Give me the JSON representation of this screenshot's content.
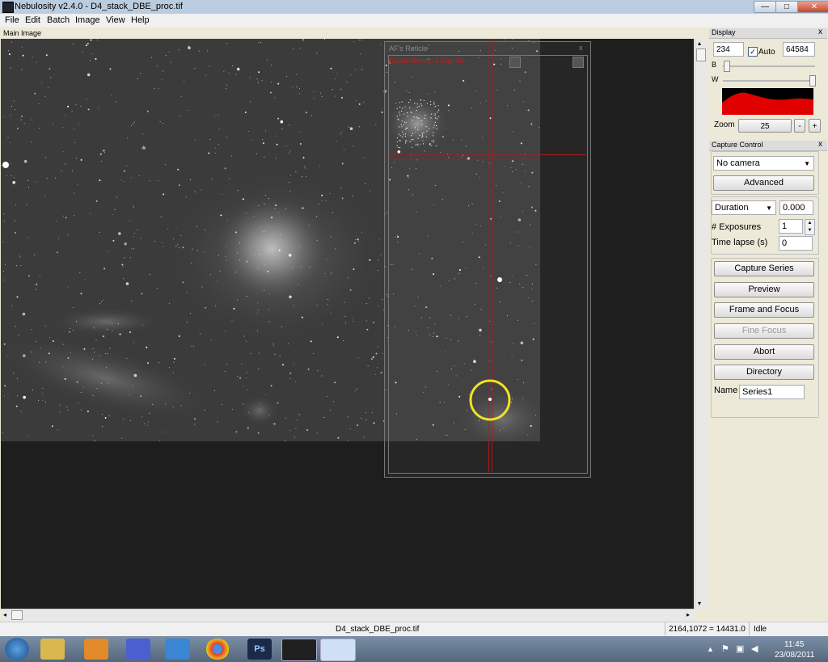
{
  "window": {
    "title": "Nebulosity v2.4.0 - D4_stack_DBE_proc.tif",
    "controls": {
      "minimize": "—",
      "maximize": "□",
      "close": "✕"
    }
  },
  "menu": [
    "File",
    "Edit",
    "Batch",
    "Image",
    "View",
    "Help"
  ],
  "main_image": {
    "label": "Main Image"
  },
  "reticle": {
    "title": "AF's Reticle",
    "close": "x",
    "field_text": "Enable Ret  Inc:  9    Gap:  50"
  },
  "display": {
    "header": "Display",
    "close": "x",
    "black_value": "234",
    "auto_label": "Auto",
    "auto_checked": true,
    "white_value": "64584",
    "b_label": "B",
    "w_label": "W",
    "zoom_label": "Zoom",
    "zoom_value": "25",
    "zoom_minus": "-",
    "zoom_plus": "+",
    "histogram_color": "#e00000"
  },
  "capture": {
    "header": "Capture Control",
    "close": "x",
    "camera_select": "No camera",
    "advanced_button": "Advanced",
    "duration_select": "Duration",
    "duration_value": "0.000",
    "exposures_label": "# Exposures",
    "exposures_value": "1",
    "timelapse_label": "Time lapse (s)",
    "timelapse_value": "0",
    "buttons": {
      "capture_series": "Capture Series",
      "preview": "Preview",
      "frame_focus": "Frame and Focus",
      "fine_focus": "Fine Focus",
      "abort": "Abort",
      "directory": "Directory"
    },
    "name_label": "Name",
    "name_value": "Series1"
  },
  "status": {
    "filename": "D4_stack_DBE_proc.tif",
    "pixel_readout": "2164,1072 = 14431.0",
    "state": "Idle"
  },
  "taskbar": {
    "time": "11:45",
    "date": "23/08/2011",
    "apps": [
      "start-orb",
      "explorer-icon",
      "media-player-icon",
      "app-cube-icon",
      "internet-explorer-icon",
      "chrome-icon",
      "photoshop-icon",
      "nebulosity-icon",
      "window-icon"
    ],
    "photoshop_label": "Ps"
  }
}
